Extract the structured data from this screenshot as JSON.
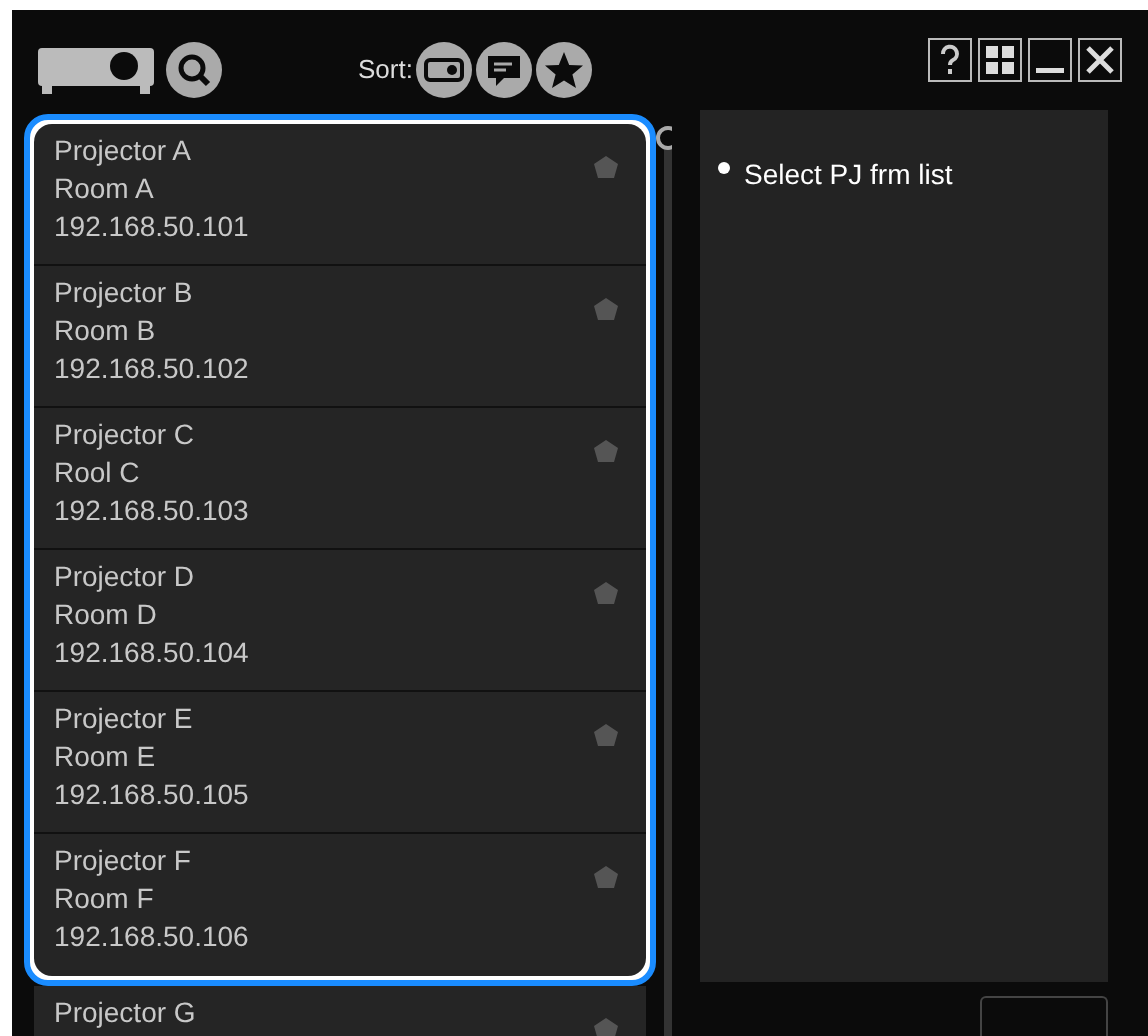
{
  "toolbar": {
    "sort_label": "Sort:"
  },
  "projectors": [
    {
      "name": "Projector A",
      "room": "Room A",
      "ip": "192.168.50.101",
      "selected": true
    },
    {
      "name": "Projector B",
      "room": "Room B",
      "ip": "192.168.50.102",
      "selected": true
    },
    {
      "name": "Projector C",
      "room": "Rool C",
      "ip": "192.168.50.103",
      "selected": true
    },
    {
      "name": "Projector D",
      "room": "Room D",
      "ip": "192.168.50.104",
      "selected": true
    },
    {
      "name": "Projector E",
      "room": "Room E",
      "ip": "192.168.50.105",
      "selected": true
    },
    {
      "name": "Projector F",
      "room": "Room F",
      "ip": "192.168.50.106",
      "selected": true
    },
    {
      "name": "Projector G",
      "selected": false
    }
  ],
  "detail": {
    "message": "Select PJ frm list"
  }
}
